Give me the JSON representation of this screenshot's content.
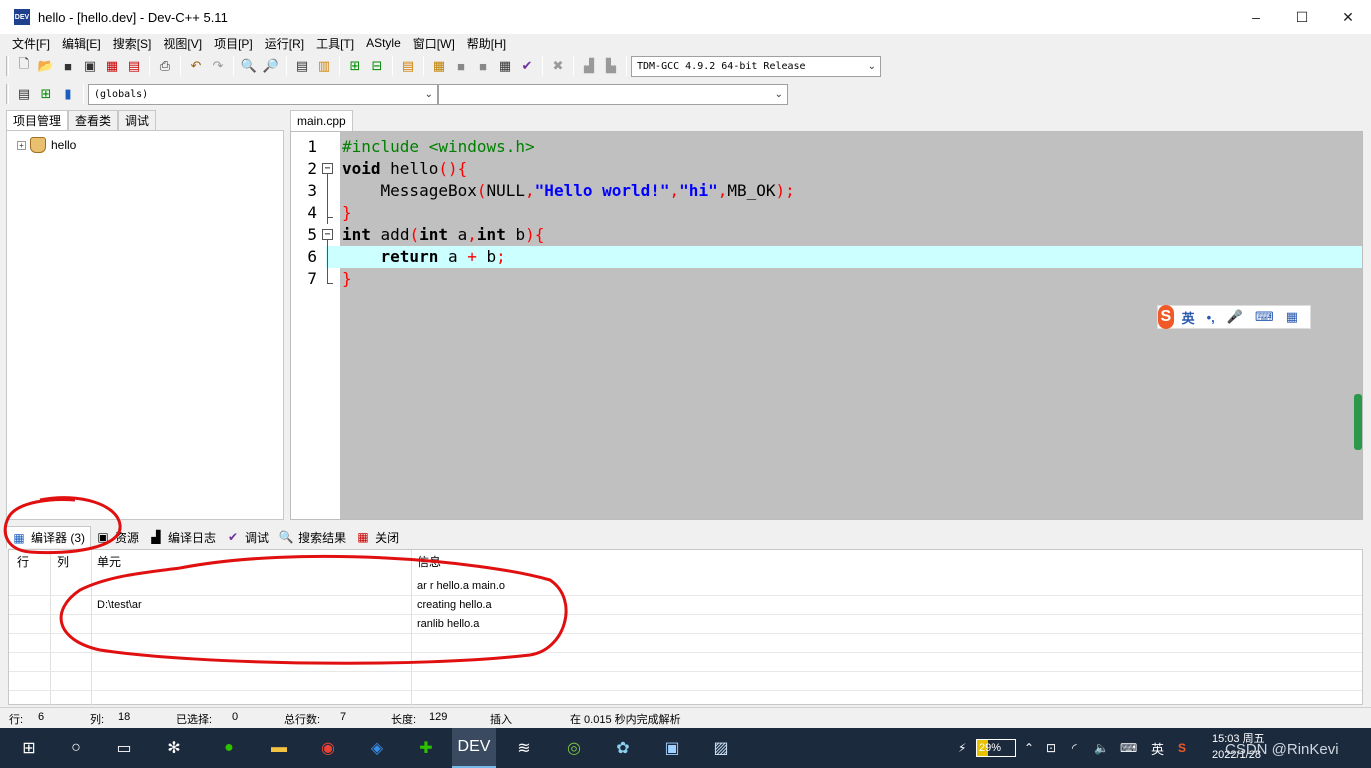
{
  "window": {
    "title": "hello - [hello.dev] - Dev-C++ 5.11",
    "app_icon_text": "DEV",
    "controls": [
      "–",
      "☐",
      "✕"
    ]
  },
  "menu": [
    "文件[F]",
    "编辑[E]",
    "搜索[S]",
    "视图[V]",
    "项目[P]",
    "运行[R]",
    "工具[T]",
    "AStyle",
    "窗口[W]",
    "帮助[H]"
  ],
  "toolbar": {
    "compiler_select": "TDM-GCC 4.9.2 64-bit Release",
    "scope_select": "(globals)",
    "member_select": ""
  },
  "left_panel": {
    "tabs": [
      "项目管理",
      "查看类",
      "调试"
    ],
    "tree": [
      {
        "label": "hello",
        "expander": "+"
      }
    ]
  },
  "editor": {
    "tab": "main.cpp",
    "line_numbers": [
      "1",
      "2",
      "3",
      "4",
      "5",
      "6",
      "7"
    ],
    "highlight_line": 6,
    "colors": {
      "background": "#c0c0c0",
      "highlight": "#ccffff",
      "preprocessor": "#008000",
      "string": "#0000ff",
      "symbol": "#ff0000"
    }
  },
  "ime": {
    "logo": "S",
    "items": [
      "英",
      "•,",
      "🎤",
      "⌨",
      "▦"
    ]
  },
  "bottom_panel": {
    "tabs": [
      {
        "label": "编译器 (3)",
        "icon": "grid-icon"
      },
      {
        "label": "资源",
        "icon": "resource-icon"
      },
      {
        "label": "编译日志",
        "icon": "chart-icon"
      },
      {
        "label": "调试",
        "icon": "check-icon"
      },
      {
        "label": "搜索结果",
        "icon": "search-icon"
      },
      {
        "label": "关闭",
        "icon": "close-icon"
      }
    ],
    "columns": [
      "行",
      "列",
      "单元",
      "信息"
    ],
    "rows": [
      {
        "line": "",
        "col": "",
        "unit": "",
        "message": "ar r hello.a main.o"
      },
      {
        "line": "",
        "col": "",
        "unit": "D:\\test\\ar",
        "message": "creating hello.a"
      },
      {
        "line": "",
        "col": "",
        "unit": "",
        "message": "ranlib hello.a"
      }
    ]
  },
  "statusbar": {
    "line_label": "行:",
    "line_value": "6",
    "col_label": "列:",
    "col_value": "18",
    "sel_label": "已选择:",
    "sel_value": "0",
    "total_label": "总行数:",
    "total_value": "7",
    "len_label": "长度:",
    "len_value": "129",
    "mode": "插入",
    "message": "在 0.015 秒内完成解析"
  },
  "taskbar": {
    "battery": "29%",
    "lang": "英",
    "time": "15:03 周五",
    "date": "2022/1/28",
    "watermark": "CSDN @RinKevi"
  }
}
